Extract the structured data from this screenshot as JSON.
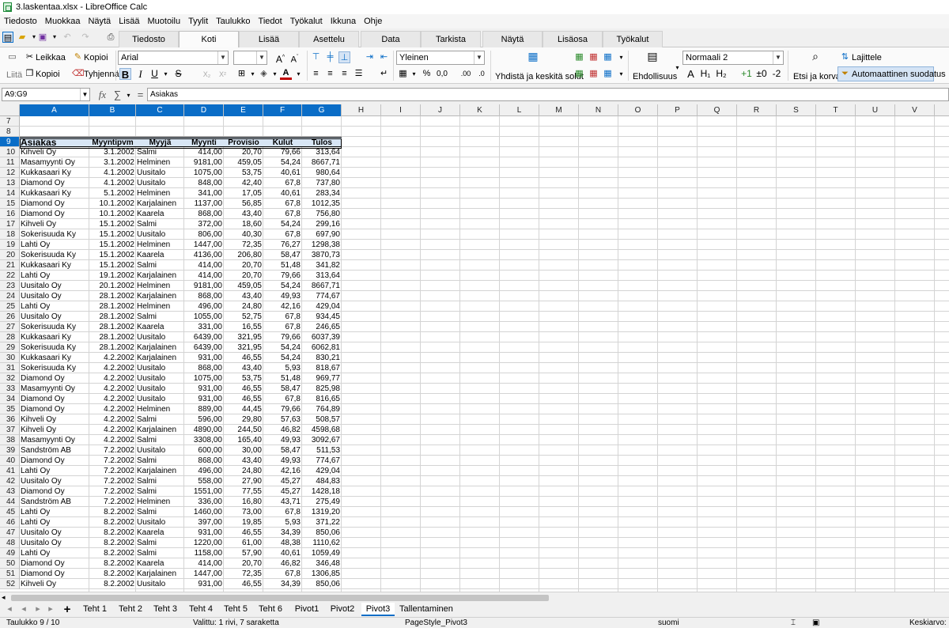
{
  "window": {
    "title": "3.laskentaa.xlsx - LibreOffice Calc"
  },
  "menu": [
    "Tiedosto",
    "Muokkaa",
    "Näytä",
    "Lisää",
    "Muotoilu",
    "Tyylit",
    "Taulukko",
    "Tiedot",
    "Työkalut",
    "Ikkuna",
    "Ohje"
  ],
  "tabs": [
    "Tiedosto",
    "Koti",
    "Lisää",
    "Asettelu",
    "Data",
    "Tarkista",
    "Näytä",
    "Lisäosa",
    "Työkalut"
  ],
  "ribbon": {
    "cut": "Leikkaa",
    "copy": "Kopioi",
    "paste": "Liitä",
    "clone": "Kopioi",
    "clear": "Tyhjennä",
    "font_name": "Arial",
    "font_size": "",
    "number_format": "Yleinen",
    "merge": "Yhdistä ja keskitä solut",
    "conditional": "Ehdollisuus",
    "style": "Normaali 2",
    "find": "Etsi ja korvaa",
    "sort": "Lajittele",
    "autofilter": "Automaattinen suodatus",
    "bold": "B",
    "italic": "I",
    "underline": "U",
    "strike": "S",
    "percent": "%",
    "decimal": "0,0",
    "h0": "A",
    "h1": "H₁",
    "h2": "H₂",
    "plus1": "+1",
    "pm0": "±0",
    "minus2": "-2"
  },
  "formula": {
    "cell_ref": "A9:G9",
    "content": "Asiakas"
  },
  "columns": [
    "A",
    "B",
    "C",
    "D",
    "E",
    "F",
    "G",
    "H",
    "I",
    "J",
    "K",
    "L",
    "M",
    "N",
    "O",
    "P",
    "Q",
    "R",
    "S",
    "T",
    "U",
    "V"
  ],
  "table": {
    "headers": [
      "Asiakas",
      "Myyntipvm",
      "Myyjä",
      "Myynti",
      "Provisio",
      "Kulut",
      "Tulos"
    ],
    "first_row": 10,
    "rows": [
      [
        "Kihveli Oy",
        "3.1.2002",
        "Salmi",
        "414,00",
        "20,70",
        "79,66",
        "313,64"
      ],
      [
        "Masamyynti Oy",
        "3.1.2002",
        "Helminen",
        "9181,00",
        "459,05",
        "54,24",
        "8667,71"
      ],
      [
        "Kukkasaari Ky",
        "4.1.2002",
        "Uusitalo",
        "1075,00",
        "53,75",
        "40,61",
        "980,64"
      ],
      [
        "Diamond Oy",
        "4.1.2002",
        "Uusitalo",
        "848,00",
        "42,40",
        "67,8",
        "737,80"
      ],
      [
        "Kukkasaari Ky",
        "5.1.2002",
        "Helminen",
        "341,00",
        "17,05",
        "40,61",
        "283,34"
      ],
      [
        "Diamond Oy",
        "10.1.2002",
        "Karjalainen",
        "1137,00",
        "56,85",
        "67,8",
        "1012,35"
      ],
      [
        "Diamond Oy",
        "10.1.2002",
        "Kaarela",
        "868,00",
        "43,40",
        "67,8",
        "756,80"
      ],
      [
        "Kihveli Oy",
        "15.1.2002",
        "Salmi",
        "372,00",
        "18,60",
        "54,24",
        "299,16"
      ],
      [
        "Sokerisuuda Ky",
        "15.1.2002",
        "Uusitalo",
        "806,00",
        "40,30",
        "67,8",
        "697,90"
      ],
      [
        "Lahti Oy",
        "15.1.2002",
        "Helminen",
        "1447,00",
        "72,35",
        "76,27",
        "1298,38"
      ],
      [
        "Sokerisuuda Ky",
        "15.1.2002",
        "Kaarela",
        "4136,00",
        "206,80",
        "58,47",
        "3870,73"
      ],
      [
        "Kukkasaari Ky",
        "15.1.2002",
        "Salmi",
        "414,00",
        "20,70",
        "51,48",
        "341,82"
      ],
      [
        "Lahti Oy",
        "19.1.2002",
        "Karjalainen",
        "414,00",
        "20,70",
        "79,66",
        "313,64"
      ],
      [
        "Uusitalo Oy",
        "20.1.2002",
        "Helminen",
        "9181,00",
        "459,05",
        "54,24",
        "8667,71"
      ],
      [
        "Uusitalo Oy",
        "28.1.2002",
        "Karjalainen",
        "868,00",
        "43,40",
        "49,93",
        "774,67"
      ],
      [
        "Lahti Oy",
        "28.1.2002",
        "Helminen",
        "496,00",
        "24,80",
        "42,16",
        "429,04"
      ],
      [
        "Uusitalo Oy",
        "28.1.2002",
        "Salmi",
        "1055,00",
        "52,75",
        "67,8",
        "934,45"
      ],
      [
        "Sokerisuuda Ky",
        "28.1.2002",
        "Kaarela",
        "331,00",
        "16,55",
        "67,8",
        "246,65"
      ],
      [
        "Kukkasaari Ky",
        "28.1.2002",
        "Uusitalo",
        "6439,00",
        "321,95",
        "79,66",
        "6037,39"
      ],
      [
        "Sokerisuuda Ky",
        "28.1.2002",
        "Karjalainen",
        "6439,00",
        "321,95",
        "54,24",
        "6062,81"
      ],
      [
        "Kukkasaari Ky",
        "4.2.2002",
        "Karjalainen",
        "931,00",
        "46,55",
        "54,24",
        "830,21"
      ],
      [
        "Sokerisuuda Ky",
        "4.2.2002",
        "Uusitalo",
        "868,00",
        "43,40",
        "5,93",
        "818,67"
      ],
      [
        "Diamond Oy",
        "4.2.2002",
        "Uusitalo",
        "1075,00",
        "53,75",
        "51,48",
        "969,77"
      ],
      [
        "Masamyynti Oy",
        "4.2.2002",
        "Uusitalo",
        "931,00",
        "46,55",
        "58,47",
        "825,98"
      ],
      [
        "Diamond Oy",
        "4.2.2002",
        "Uusitalo",
        "931,00",
        "46,55",
        "67,8",
        "816,65"
      ],
      [
        "Diamond Oy",
        "4.2.2002",
        "Helminen",
        "889,00",
        "44,45",
        "79,66",
        "764,89"
      ],
      [
        "Kihveli Oy",
        "4.2.2002",
        "Salmi",
        "596,00",
        "29,80",
        "57,63",
        "508,57"
      ],
      [
        "Kihveli Oy",
        "4.2.2002",
        "Karjalainen",
        "4890,00",
        "244,50",
        "46,82",
        "4598,68"
      ],
      [
        "Masamyynti Oy",
        "4.2.2002",
        "Salmi",
        "3308,00",
        "165,40",
        "49,93",
        "3092,67"
      ],
      [
        "Sandström AB",
        "7.2.2002",
        "Uusitalo",
        "600,00",
        "30,00",
        "58,47",
        "511,53"
      ],
      [
        "Diamond Oy",
        "7.2.2002",
        "Salmi",
        "868,00",
        "43,40",
        "49,93",
        "774,67"
      ],
      [
        "Lahti Oy",
        "7.2.2002",
        "Karjalainen",
        "496,00",
        "24,80",
        "42,16",
        "429,04"
      ],
      [
        "Uusitalo Oy",
        "7.2.2002",
        "Salmi",
        "558,00",
        "27,90",
        "45,27",
        "484,83"
      ],
      [
        "Diamond Oy",
        "7.2.2002",
        "Salmi",
        "1551,00",
        "77,55",
        "45,27",
        "1428,18"
      ],
      [
        "Sandström AB",
        "7.2.2002",
        "Helminen",
        "336,00",
        "16,80",
        "43,71",
        "275,49"
      ],
      [
        "Lahti Oy",
        "8.2.2002",
        "Salmi",
        "1460,00",
        "73,00",
        "67,8",
        "1319,20"
      ],
      [
        "Lahti Oy",
        "8.2.2002",
        "Uusitalo",
        "397,00",
        "19,85",
        "5,93",
        "371,22"
      ],
      [
        "Uusitalo Oy",
        "8.2.2002",
        "Kaarela",
        "931,00",
        "46,55",
        "34,39",
        "850,06"
      ],
      [
        "Uusitalo Oy",
        "8.2.2002",
        "Salmi",
        "1220,00",
        "61,00",
        "48,38",
        "1110,62"
      ],
      [
        "Lahti Oy",
        "8.2.2002",
        "Salmi",
        "1158,00",
        "57,90",
        "40,61",
        "1059,49"
      ],
      [
        "Diamond Oy",
        "8.2.2002",
        "Kaarela",
        "414,00",
        "20,70",
        "46,82",
        "346,48"
      ],
      [
        "Diamond Oy",
        "8.2.2002",
        "Karjalainen",
        "1447,00",
        "72,35",
        "67,8",
        "1306,85"
      ],
      [
        "Kihveli Oy",
        "8.2.2002",
        "Uusitalo",
        "931,00",
        "46,55",
        "34,39",
        "850,06"
      ]
    ]
  },
  "sheets": [
    "Teht 1",
    "Teht 2",
    "Teht 3",
    "Teht 4",
    "Teht 5",
    "Teht 6",
    "Pivot1",
    "Pivot2",
    "Pivot3",
    "Tallentaminen"
  ],
  "active_sheet": "Pivot3",
  "status": {
    "sheet": "Taulukko 9 / 10",
    "selection": "Valittu: 1 rivi, 7 saraketta",
    "page_style": "PageStyle_Pivot3",
    "language": "suomi",
    "average": "Keskiarvo: ;"
  }
}
